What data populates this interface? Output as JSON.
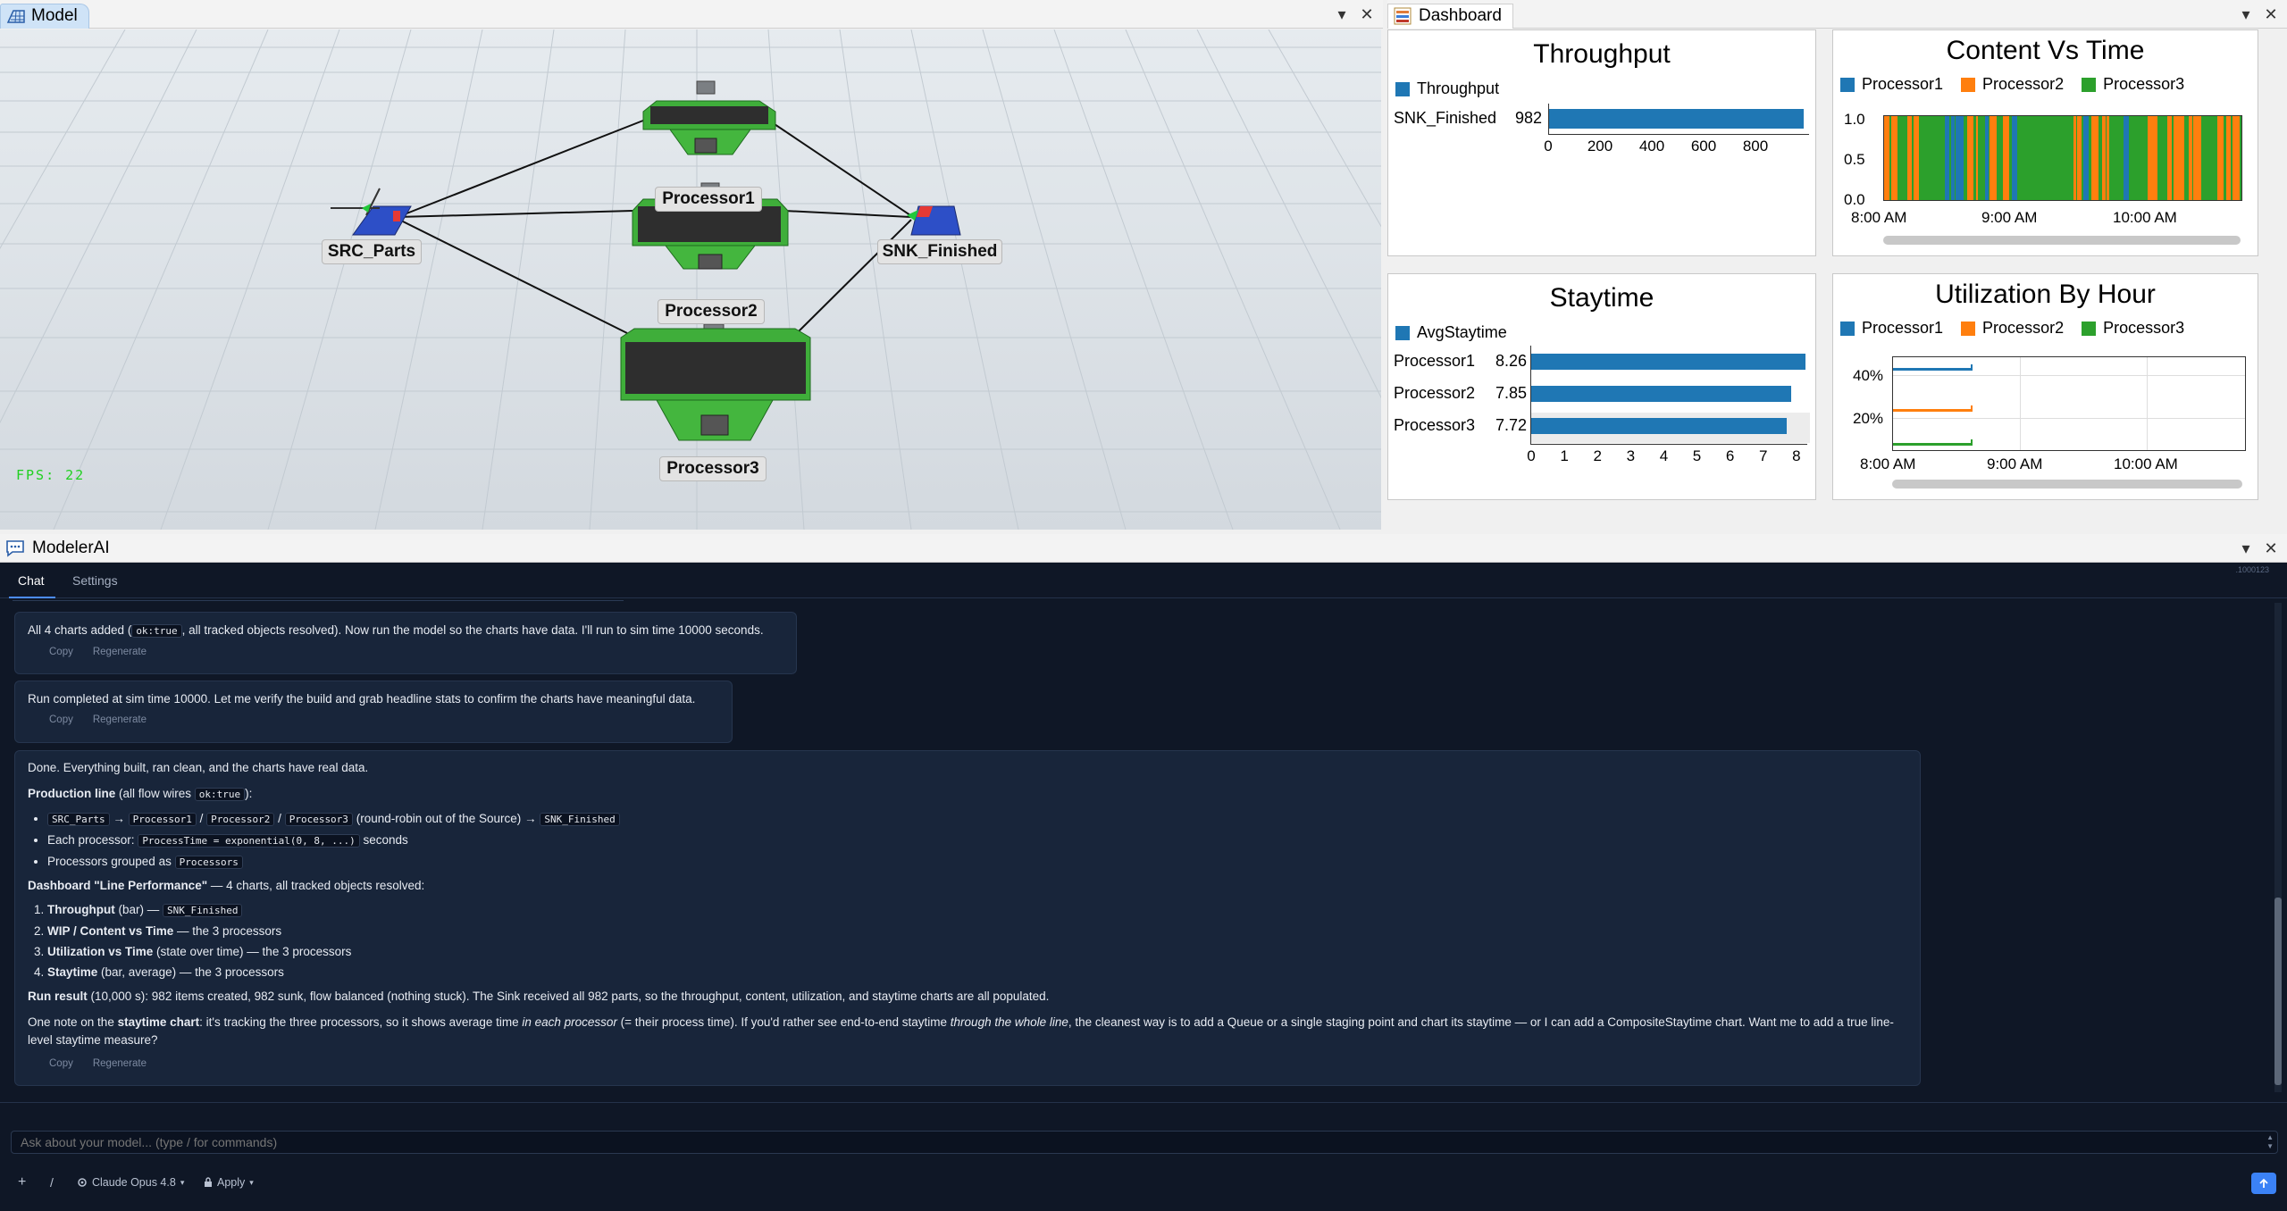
{
  "model_tab": {
    "title": "Model"
  },
  "dashboard_tab": {
    "title": "Dashboard"
  },
  "model_view": {
    "nodes": [
      {
        "name": "SRC_Parts"
      },
      {
        "name": "Processor1"
      },
      {
        "name": "Processor2"
      },
      {
        "name": "Processor3"
      },
      {
        "name": "SNK_Finished"
      }
    ],
    "fps": "FPS: 22"
  },
  "throughput": {
    "title": "Throughput",
    "legend": "Throughput",
    "row_label": "SNK_Finished",
    "row_value_text": "982",
    "ticks": [
      "0",
      "200",
      "400",
      "600",
      "800"
    ],
    "chart_data": {
      "type": "bar",
      "categories": [
        "SNK_Finished"
      ],
      "values": [
        982
      ],
      "xlim": [
        0,
        1000
      ],
      "color": "#1f77b4"
    }
  },
  "content": {
    "title": "Content Vs Time",
    "legend": [
      "Processor1",
      "Processor2",
      "Processor3"
    ],
    "yticks": [
      "1.0",
      "0.5",
      "0.0"
    ],
    "xticks": [
      "8:00 AM",
      "9:00 AM",
      "10:00 AM"
    ],
    "chart_data": {
      "type": "area",
      "series": [
        {
          "name": "Processor1",
          "color": "#1f77b4"
        },
        {
          "name": "Processor2",
          "color": "#ff7f0e"
        },
        {
          "name": "Processor3",
          "color": "#2ca02c"
        }
      ],
      "ylim": [
        0,
        1
      ]
    }
  },
  "staytime": {
    "title": "Staytime",
    "legend": "AvgStaytime",
    "rows": [
      {
        "label": "Processor1",
        "value_text": "8.26"
      },
      {
        "label": "Processor2",
        "value_text": "7.85"
      },
      {
        "label": "Processor3",
        "value_text": "7.72"
      }
    ],
    "ticks": [
      "0",
      "1",
      "2",
      "3",
      "4",
      "5",
      "6",
      "7",
      "8"
    ],
    "chart_data": {
      "type": "bar",
      "categories": [
        "Processor1",
        "Processor2",
        "Processor3"
      ],
      "values": [
        8.26,
        7.85,
        7.72
      ],
      "xlim": [
        0,
        8.3
      ],
      "color": "#1f77b4"
    }
  },
  "utilization": {
    "title": "Utilization By Hour",
    "legend": [
      "Processor1",
      "Processor2",
      "Processor3"
    ],
    "yticks": [
      "40%",
      "20%"
    ],
    "xticks": [
      "8:00 AM",
      "9:00 AM",
      "10:00 AM"
    ],
    "chart_data": {
      "type": "line",
      "series": [
        {
          "name": "Processor1",
          "values": [
            49
          ],
          "color": "#1f77b4"
        },
        {
          "name": "Processor2",
          "values": [
            25
          ],
          "color": "#ff7f0e"
        },
        {
          "name": "Processor3",
          "values": [
            5
          ],
          "color": "#2ca02c"
        }
      ]
    }
  },
  "modelerai": {
    "title": "ModelerAI",
    "tabs": [
      "Chat",
      "Settings"
    ],
    "version": ".1000123",
    "messages": {
      "m1": {
        "pre": "All 4 charts added (",
        "code": "ok:true",
        "post": ", all tracked objects resolved). Now run the model so the charts have data. I'll run to sim time 10000 seconds."
      },
      "m2": {
        "text": "Run completed at sim time 10000. Let me verify the build and grab headline stats to confirm the charts have meaningful data."
      },
      "m3": {
        "intro": "Done. Everything built, ran clean, and the charts have real data.",
        "prod_b": "Production line",
        "prod_t": " (all flow wires ",
        "prod_c": "ok:true",
        "prod_e": "):",
        "b1_c1": "SRC_Parts",
        "arrow": "→",
        "b1_c2": "Processor1",
        "slash": "/",
        "b1_c3": "Processor2",
        "b1_c4": "Processor3",
        "b1_t": "(round-robin out of the Source) →",
        "b1_c5": "SNK_Finished",
        "b2_t": "Each processor:",
        "b2_c": "ProcessTime = exponential(0, 8, ...)",
        "b2_e": "seconds",
        "b3_t": "Processors grouped as",
        "b3_c": "Processors",
        "dash_b": "Dashboard \"Line Performance\"",
        "dash_t": " — 4 charts, all tracked objects resolved:",
        "o1_b": "Throughput",
        "o1_t": " (bar) — ",
        "o1_c": "SNK_Finished",
        "o2_b": "WIP / Content vs Time",
        "o2_t": " — the 3 processors",
        "o3_b": "Utilization vs Time",
        "o3_t": " (state over time) — the 3 processors",
        "o4_b": "Staytime",
        "o4_t": " (bar, average) — the 3 processors",
        "run_b": "Run result",
        "run_t": " (10,000 s): 982 items created, 982 sunk, flow balanced (nothing stuck). The Sink received all 982 parts, so the throughput, content, utilization, and staytime charts are all populated.",
        "note_t1": "One note on the ",
        "note_b": "staytime chart",
        "note_t2": ": it's tracking the three processors, so it shows average time ",
        "note_i1": "in each processor",
        "note_t3": " (= their process time). If you'd rather see end-to-end staytime ",
        "note_i2": "through the whole line",
        "note_t4": ", the cleanest way is to add a Queue or a single staging point and chart its staytime — or I can add a CompositeStaytime chart. Want me to add a true line-level staytime measure?"
      }
    },
    "copy": "Copy",
    "regen": "Regenerate",
    "input_placeholder": "Ask about your model... (type / for commands)",
    "plus": "+",
    "slash_btn": "/",
    "model_selector": "Claude Opus 4.8",
    "apply": "Apply"
  }
}
